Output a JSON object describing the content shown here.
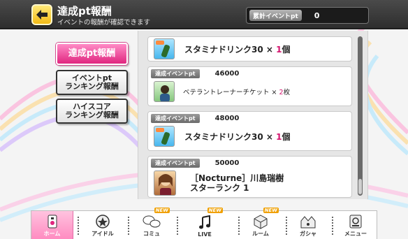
{
  "header": {
    "title": "達成pt報酬",
    "subtitle": "イベントの報酬が確認できます",
    "total_label": "累計イベントpt",
    "total_value": "0"
  },
  "side_menu": [
    {
      "label": "達成pt報酬",
      "active": true
    },
    {
      "label_line1": "イベントpt",
      "label_line2": "ランキング報酬"
    },
    {
      "label_line1": "ハイスコア",
      "label_line2": "ランキング報酬"
    }
  ],
  "rewards": [
    {
      "icon": "stamina-drink-icon",
      "name": "スタミナドリンク30",
      "times": "×",
      "qty": "1",
      "unit": "個"
    },
    {
      "tag": "達成イベントpt",
      "points": "46000",
      "icon": "veteran-trainer-ticket-icon",
      "name": "ベテラントレーナーチケット",
      "times": "×",
      "qty": "2",
      "unit": "枚"
    },
    {
      "tag": "達成イベントpt",
      "points": "48000",
      "icon": "stamina-drink-icon",
      "name": "スタミナドリンク30",
      "times": "×",
      "qty": "1",
      "unit": "個"
    },
    {
      "tag": "達成イベントpt",
      "points": "50000",
      "icon": "idol-card-icon",
      "name_line1": "［Nocturne］川島瑞樹",
      "name_line2": "スターランク 1"
    }
  ],
  "nav": [
    {
      "label": "ホーム",
      "icon": "home-icon"
    },
    {
      "label": "アイドル",
      "icon": "idol-icon"
    },
    {
      "label": "コミュ",
      "icon": "commu-icon",
      "badge": "NEW"
    },
    {
      "label": "LIVE",
      "icon": "live-icon",
      "badge": "NEW"
    },
    {
      "label": "ルーム",
      "icon": "room-icon",
      "badge": "NEW"
    },
    {
      "label": "ガシャ",
      "icon": "gacha-icon"
    },
    {
      "label": "メニュー",
      "icon": "menu-icon"
    }
  ],
  "colors": {
    "accent_pink": "#e0267f",
    "quantity": "#d4146e",
    "back_button": "#f2bb16"
  }
}
